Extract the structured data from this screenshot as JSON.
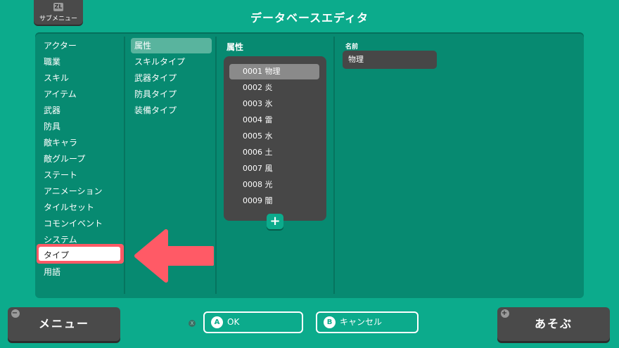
{
  "top_button": {
    "badge": "ZL",
    "label": "サブメニュー"
  },
  "title": "データベースエディタ",
  "categories": [
    "アクター",
    "職業",
    "スキル",
    "アイテム",
    "武器",
    "防具",
    "敵キャラ",
    "敵グループ",
    "ステート",
    "アニメーション",
    "タイルセット",
    "コモンイベント",
    "システム",
    "タイプ",
    "用語"
  ],
  "selected_category": "タイプ",
  "subcategories": [
    "属性",
    "スキルタイプ",
    "武器タイプ",
    "防具タイプ",
    "装備タイプ"
  ],
  "selected_subcategory": "属性",
  "attribute_list": {
    "header": "属性",
    "rows": [
      "0001 物理",
      "0002 炎",
      "0003 氷",
      "0004 雷",
      "0005 水",
      "0006 土",
      "0007 風",
      "0008 光",
      "0009 闇"
    ],
    "add_symbol": "+"
  },
  "detail": {
    "name_label": "名前",
    "name_value": "物理"
  },
  "bottom": {
    "menu": {
      "badge": "−",
      "label": "メニュー"
    },
    "x_badge": "X",
    "ok": {
      "badge": "A",
      "label": "OK"
    },
    "cancel": {
      "badge": "B",
      "label": "キャンセル"
    },
    "play": {
      "badge": "+",
      "label": "あそぶ"
    }
  },
  "colors": {
    "background": "#0cab8c",
    "panel": "#078a71",
    "highlight_outline": "#ff5a66"
  }
}
